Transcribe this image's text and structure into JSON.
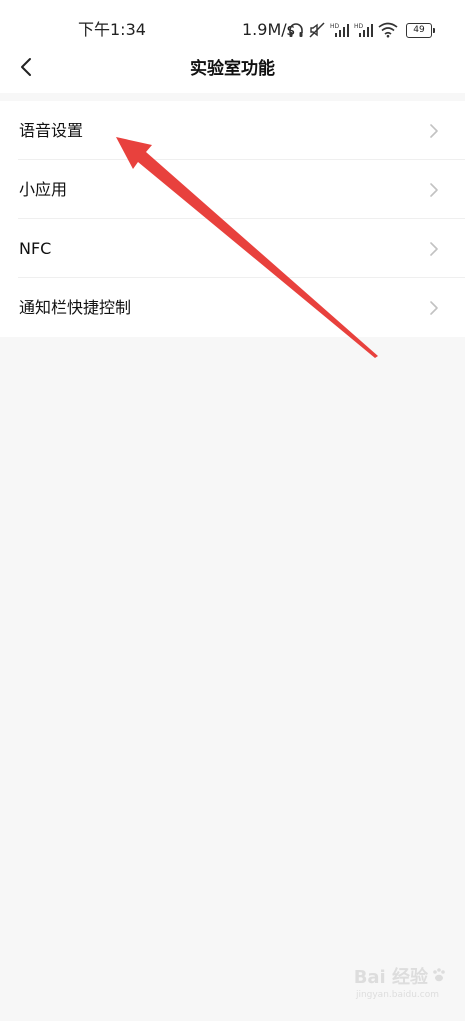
{
  "status_bar": {
    "time": "下午1:34",
    "network_speed": "1.9M/s",
    "icons": [
      "headphones-icon",
      "mute-icon",
      "hd-signal-icon",
      "hd-signal-icon",
      "wifi-icon"
    ],
    "battery_level": "49"
  },
  "nav": {
    "back_icon": "chevron-left-icon",
    "title": "实验室功能"
  },
  "menu": {
    "items": [
      {
        "label": "语音设置"
      },
      {
        "label": "小应用"
      },
      {
        "label": "NFC"
      },
      {
        "label": "通知栏快捷控制"
      }
    ]
  },
  "annotation": {
    "arrow_color": "#e8413d",
    "points_to": "语音设置"
  },
  "watermark": {
    "logo_mark": "paw-icon",
    "main": "Bai  经验",
    "sub": "jingyan.baidu.com"
  },
  "colors": {
    "background": "#f7f7f7",
    "surface": "#ffffff",
    "text": "#111111",
    "chevron": "#c2c2c2"
  }
}
